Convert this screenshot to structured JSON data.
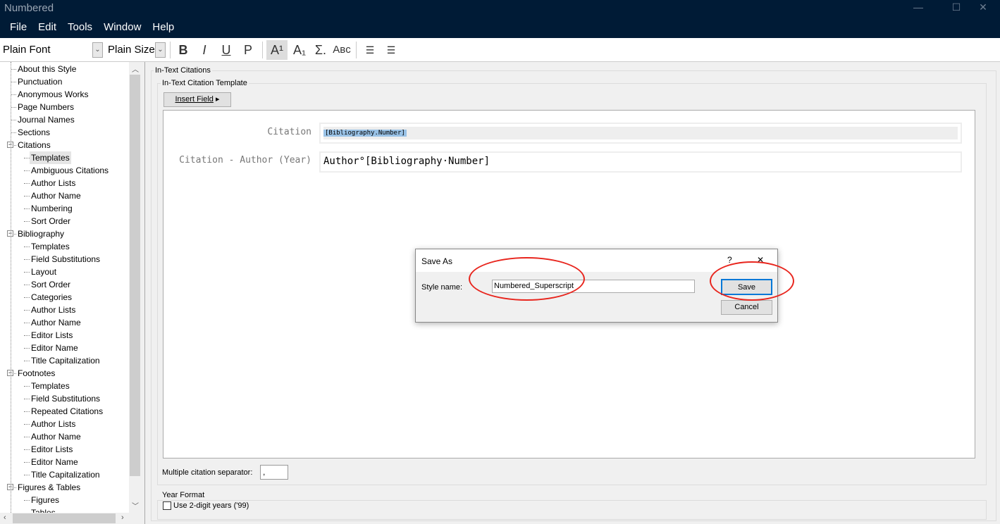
{
  "window": {
    "title": "Numbered"
  },
  "menu": [
    "File",
    "Edit",
    "Tools",
    "Window",
    "Help"
  ],
  "toolbar": {
    "font": "Plain Font",
    "size": "Plain Size",
    "bold": "B",
    "italic": "I",
    "underline": "U",
    "plain": "P",
    "superscript": "A¹",
    "subscript": "A₁",
    "symbol": "Σ.",
    "smallcaps": "Aʙᴄ"
  },
  "tree": [
    {
      "label": "About this Style",
      "level": 0
    },
    {
      "label": "Punctuation",
      "level": 0
    },
    {
      "label": "Anonymous Works",
      "level": 0
    },
    {
      "label": "Page Numbers",
      "level": 0
    },
    {
      "label": "Journal Names",
      "level": 0
    },
    {
      "label": "Sections",
      "level": 0
    },
    {
      "label": "Citations",
      "level": 0,
      "expander": true
    },
    {
      "label": "Templates",
      "level": 1,
      "selected": true
    },
    {
      "label": "Ambiguous Citations",
      "level": 1
    },
    {
      "label": "Author Lists",
      "level": 1
    },
    {
      "label": "Author Name",
      "level": 1
    },
    {
      "label": "Numbering",
      "level": 1
    },
    {
      "label": "Sort Order",
      "level": 1
    },
    {
      "label": "Bibliography",
      "level": 0,
      "expander": true
    },
    {
      "label": "Templates",
      "level": 1
    },
    {
      "label": "Field Substitutions",
      "level": 1
    },
    {
      "label": "Layout",
      "level": 1
    },
    {
      "label": "Sort Order",
      "level": 1
    },
    {
      "label": "Categories",
      "level": 1
    },
    {
      "label": "Author Lists",
      "level": 1
    },
    {
      "label": "Author Name",
      "level": 1
    },
    {
      "label": "Editor Lists",
      "level": 1
    },
    {
      "label": "Editor Name",
      "level": 1
    },
    {
      "label": "Title Capitalization",
      "level": 1
    },
    {
      "label": "Footnotes",
      "level": 0,
      "expander": true
    },
    {
      "label": "Templates",
      "level": 1
    },
    {
      "label": "Field Substitutions",
      "level": 1
    },
    {
      "label": "Repeated Citations",
      "level": 1
    },
    {
      "label": "Author Lists",
      "level": 1
    },
    {
      "label": "Author Name",
      "level": 1
    },
    {
      "label": "Editor Lists",
      "level": 1
    },
    {
      "label": "Editor Name",
      "level": 1
    },
    {
      "label": "Title Capitalization",
      "level": 1
    },
    {
      "label": "Figures & Tables",
      "level": 0,
      "expander": true
    },
    {
      "label": "Figures",
      "level": 1
    },
    {
      "label": "Tables",
      "level": 1
    }
  ],
  "main": {
    "section": "In-Text Citations",
    "template_group": "In-Text Citation Template",
    "insert_field": "Insert Field",
    "citation_label": "Citation",
    "citation_value": "[Bibliography.Number]",
    "author_year_label": "Citation - Author (Year)",
    "author_year_value": "Author°[Bibliography·Number]",
    "separator_label": "Multiple citation separator:",
    "separator_value": ",",
    "year_format_group": "Year Format",
    "two_digit_label": "Use 2-digit years ('99)",
    "two_digit_checked": false
  },
  "dialog": {
    "title": "Save As",
    "help": "?",
    "close": "✕",
    "style_name_label": "Style name:",
    "style_name_value": "Numbered_Superscript",
    "save": "Save",
    "cancel": "Cancel"
  },
  "colors": {
    "titlebar": "#001b36",
    "annotation": "#e8251d",
    "selection": "#99c2e6"
  }
}
